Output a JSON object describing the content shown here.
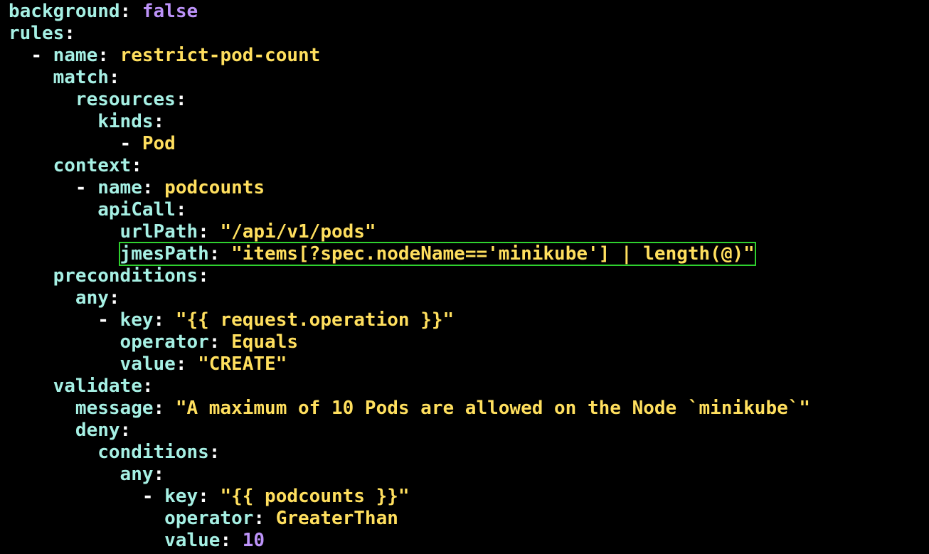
{
  "editor": {
    "lines": [
      {
        "indent": "",
        "dash": "",
        "key": "background",
        "sep": ": ",
        "value": "false",
        "vtype": "n"
      },
      {
        "indent": "",
        "dash": "",
        "key": "rules",
        "sep": ":",
        "value": "",
        "vtype": "v"
      },
      {
        "indent": "  ",
        "dash": "- ",
        "key": "name",
        "sep": ": ",
        "value": "restrict-pod-count",
        "vtype": "v"
      },
      {
        "indent": "    ",
        "dash": "",
        "key": "match",
        "sep": ":",
        "value": "",
        "vtype": "v"
      },
      {
        "indent": "      ",
        "dash": "",
        "key": "resources",
        "sep": ":",
        "value": "",
        "vtype": "v"
      },
      {
        "indent": "        ",
        "dash": "",
        "key": "kinds",
        "sep": ":",
        "value": "",
        "vtype": "v"
      },
      {
        "indent": "          ",
        "dash": "- ",
        "key": "",
        "sep": "",
        "value": "Pod",
        "vtype": "v"
      },
      {
        "indent": "    ",
        "dash": "",
        "key": "context",
        "sep": ":",
        "value": "",
        "vtype": "v"
      },
      {
        "indent": "      ",
        "dash": "- ",
        "key": "name",
        "sep": ": ",
        "value": "podcounts",
        "vtype": "v"
      },
      {
        "indent": "        ",
        "dash": "",
        "key": "apiCall",
        "sep": ":",
        "value": "",
        "vtype": "v"
      },
      {
        "indent": "          ",
        "dash": "",
        "key": "urlPath",
        "sep": ": ",
        "value": "\"/api/v1/pods\"",
        "vtype": "v"
      },
      {
        "indent": "          ",
        "dash": "",
        "key": "jmesPath",
        "sep": ": ",
        "value": "\"items[?spec.nodeName=='minikube'] | length(@)\"",
        "vtype": "v",
        "highlight": true
      },
      {
        "indent": "    ",
        "dash": "",
        "key": "preconditions",
        "sep": ":",
        "value": "",
        "vtype": "v"
      },
      {
        "indent": "      ",
        "dash": "",
        "key": "any",
        "sep": ":",
        "value": "",
        "vtype": "v"
      },
      {
        "indent": "        ",
        "dash": "- ",
        "key": "key",
        "sep": ": ",
        "value": "\"{{ request.operation }}\"",
        "vtype": "v"
      },
      {
        "indent": "          ",
        "dash": "",
        "key": "operator",
        "sep": ": ",
        "value": "Equals",
        "vtype": "v"
      },
      {
        "indent": "          ",
        "dash": "",
        "key": "value",
        "sep": ": ",
        "value": "\"CREATE\"",
        "vtype": "v"
      },
      {
        "indent": "    ",
        "dash": "",
        "key": "validate",
        "sep": ":",
        "value": "",
        "vtype": "v"
      },
      {
        "indent": "      ",
        "dash": "",
        "key": "message",
        "sep": ": ",
        "value": "\"A maximum of 10 Pods are allowed on the Node `minikube`\"",
        "vtype": "v"
      },
      {
        "indent": "      ",
        "dash": "",
        "key": "deny",
        "sep": ":",
        "value": "",
        "vtype": "v"
      },
      {
        "indent": "        ",
        "dash": "",
        "key": "conditions",
        "sep": ":",
        "value": "",
        "vtype": "v"
      },
      {
        "indent": "          ",
        "dash": "",
        "key": "any",
        "sep": ":",
        "value": "",
        "vtype": "v"
      },
      {
        "indent": "            ",
        "dash": "- ",
        "key": "key",
        "sep": ": ",
        "value": "\"{{ podcounts }}\"",
        "vtype": "v"
      },
      {
        "indent": "              ",
        "dash": "",
        "key": "operator",
        "sep": ": ",
        "value": "GreaterThan",
        "vtype": "v"
      },
      {
        "indent": "              ",
        "dash": "",
        "key": "value",
        "sep": ": ",
        "value": "10",
        "vtype": "n"
      }
    ]
  },
  "colors": {
    "background": "#000000",
    "key": "#a6f0e4",
    "string_value": "#ffdf5e",
    "literal_value": "#bd93f9",
    "punctuation": "#ffffff",
    "highlight_box": "#2fd12f"
  }
}
